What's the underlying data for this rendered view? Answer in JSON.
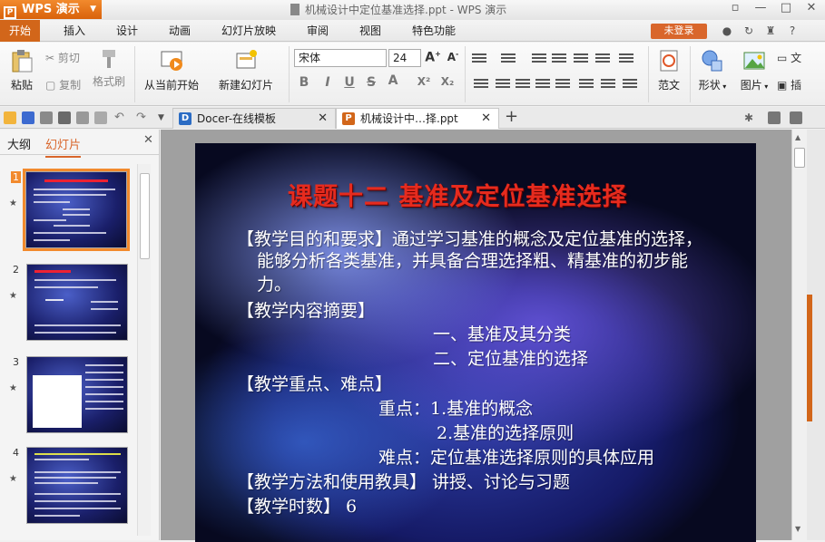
{
  "app": {
    "name": "WPS 演示",
    "logo_char": "P"
  },
  "window": {
    "title": "机械设计中定位基准选择.ppt - WPS 演示",
    "minimize": "—",
    "maximize": "□",
    "close": "✕"
  },
  "menu": {
    "tabs": [
      "开始",
      "插入",
      "设计",
      "动画",
      "幻灯片放映",
      "审阅",
      "视图",
      "特色功能"
    ],
    "login": "未登录",
    "help": "?"
  },
  "ribbon": {
    "paste": "粘贴",
    "cut": "剪切",
    "copy": "复制",
    "format_painter": "格式刷",
    "from_current": "从当前开始",
    "new_slide": "新建幻灯片",
    "font_name": "宋体",
    "font_size": "24",
    "bold": "B",
    "italic": "I",
    "underline": "U",
    "strike": "S",
    "font_color": "A",
    "superscript": "X²",
    "subscript": "X₂",
    "template": "范文",
    "shape": "形状",
    "picture": "图片",
    "textbox_partial": "文",
    "more_partial": "插"
  },
  "doctabs": [
    {
      "label": "Docer-在线模板",
      "close": "✕"
    },
    {
      "label": "机械设计中…择.ppt",
      "close": "✕"
    }
  ],
  "new_tab": "+",
  "left_panel": {
    "tabs": [
      "大纲",
      "幻灯片"
    ],
    "close": "✕",
    "slides": [
      {
        "num": "1",
        "star": "★"
      },
      {
        "num": "2",
        "star": "★"
      },
      {
        "num": "3",
        "star": "★"
      },
      {
        "num": "4",
        "star": "★"
      }
    ]
  },
  "slide": {
    "title": "课题十二  基准及定位基准选择",
    "lines": [
      "【教学目的和要求】通过学习基准的概念及定位基准的选择，",
      "能够分析各类基准，并具备合理选择粗、精基准的初步能",
      "力。",
      "【教学内容摘要】",
      "一、基准及其分类",
      "二、定位基准的选择",
      "【教学重点、难点】",
      "重点：1.基准的概念",
      "2.基准的选择原则",
      "难点：定位基准选择原则的具体应用",
      "【教学方法和使用教具】 讲授、讨论与习题",
      "【教学时数】  6"
    ]
  },
  "colors": {
    "accent": "#d2661a",
    "title_red": "#e62b1e",
    "slide_bg": "#1a2275"
  }
}
